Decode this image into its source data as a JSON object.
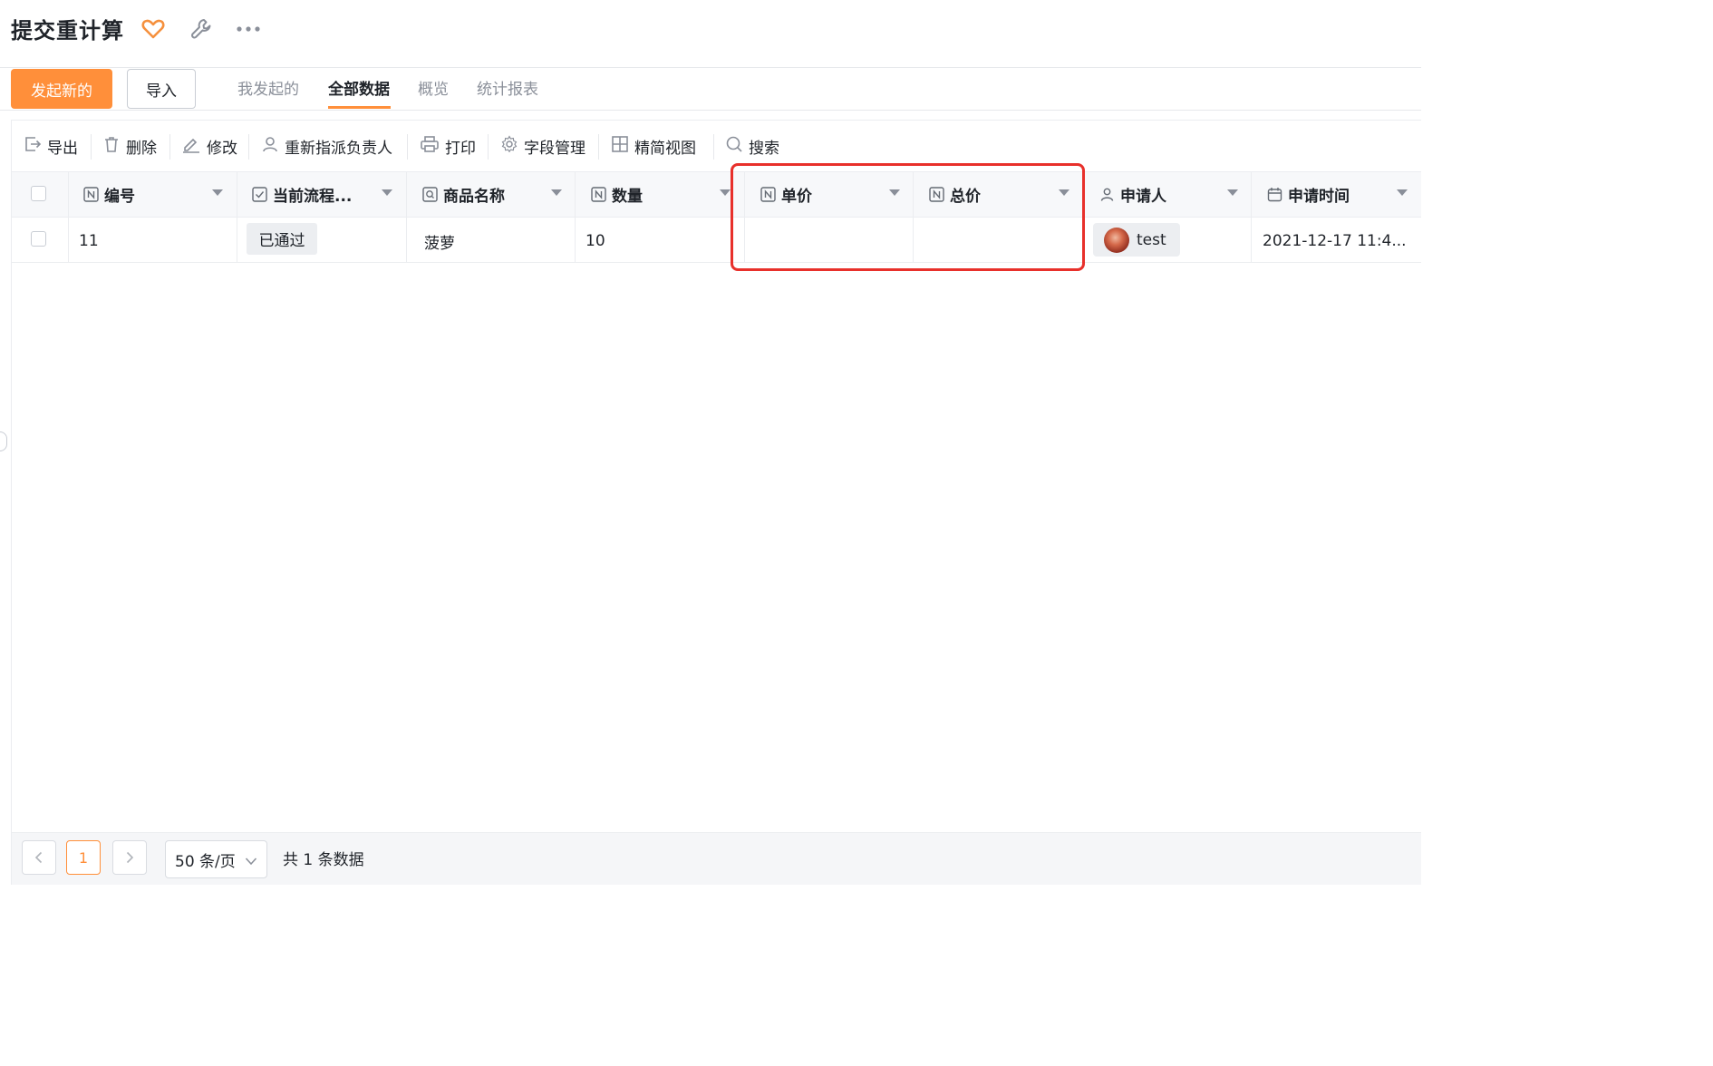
{
  "header": {
    "title": "提交重计算"
  },
  "actions": {
    "primary_label": "发起新的",
    "import_label": "导入"
  },
  "tabs": [
    {
      "label": "我发起的",
      "active": false
    },
    {
      "label": "全部数据",
      "active": true
    },
    {
      "label": "概览",
      "active": false
    },
    {
      "label": "统计报表",
      "active": false
    }
  ],
  "toolbar": {
    "export": "导出",
    "delete": "删除",
    "edit": "修改",
    "reassign": "重新指派负责人",
    "print": "打印",
    "fields": "字段管理",
    "compact": "精简视图",
    "search": "搜索"
  },
  "table": {
    "columns": [
      {
        "label": "编号",
        "icon": "number-field-icon"
      },
      {
        "label": "当前流程...",
        "icon": "checkbox-field-icon"
      },
      {
        "label": "商品名称",
        "icon": "search-field-icon"
      },
      {
        "label": "数量",
        "icon": "number-field-icon"
      },
      {
        "label": "单价",
        "icon": "number-field-icon"
      },
      {
        "label": "总价",
        "icon": "number-field-icon"
      },
      {
        "label": "申请人",
        "icon": "person-icon"
      },
      {
        "label": "申请时间",
        "icon": "calendar-icon"
      }
    ],
    "rows": [
      {
        "id": "11",
        "status": "已通过",
        "product": "菠萝",
        "quantity": "10",
        "unit_price": "",
        "total_price": "",
        "applicant": "test",
        "applied_at": "2021-12-17 11:4..."
      }
    ]
  },
  "pagination": {
    "current_page": "1",
    "page_size": "50 条/页",
    "total": "共 1 条数据"
  },
  "colors": {
    "accent": "#ff8f3a",
    "highlight": "#e8302b",
    "favorite": "#f5903d"
  }
}
